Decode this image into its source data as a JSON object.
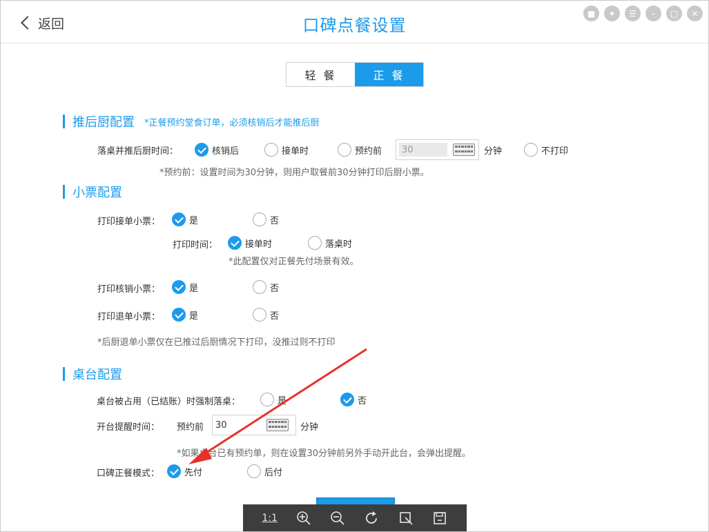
{
  "header": {
    "back_label": "返回",
    "title": "口碑点餐设置"
  },
  "tabs": [
    {
      "label": "轻 餐",
      "active": false
    },
    {
      "label": "正 餐",
      "active": true
    }
  ],
  "kitchen": {
    "heading": "推后厨配置",
    "note": "*正餐预约堂食订单，必须核销后才能推后厨",
    "row_label": "落桌并推后厨时间：",
    "options": [
      "核销后",
      "接单时",
      "预约前"
    ],
    "minutes_value": "30",
    "minutes_unit": "分钟",
    "no_print": "不打印",
    "hint": "*预约前：设置时间为30分钟，则用户取餐前30分钟打印后厨小票。"
  },
  "ticket": {
    "heading": "小票配置",
    "print_accept_label": "打印接单小票：",
    "yes": "是",
    "no": "否",
    "print_time_label": "打印时间：",
    "print_time_options": [
      "接单时",
      "落桌时"
    ],
    "print_time_hint": "*此配置仅对正餐先付场景有效。",
    "print_verify_label": "打印核销小票：",
    "print_refund_label": "打印退单小票：",
    "refund_hint": "*后厨退单小票仅在已推过后厨情况下打印，没推过则不打印"
  },
  "table": {
    "heading": "桌台配置",
    "force_label": "桌台被占用（已结账）时强制落桌：",
    "yes": "是",
    "no": "否",
    "remind_label": "开台提醒时间：",
    "remind_prefix": "预约前",
    "remind_value": "30",
    "remind_unit": "分钟",
    "remind_hint": "*如果桌台已有预约单，则在设置30分钟前另外手动开此台，会弹出提醒。",
    "mode_label": "口碑正餐模式：",
    "mode_options": [
      "先付",
      "后付"
    ]
  },
  "toolbar": {
    "ratio_label": "1:1"
  },
  "colors": {
    "accent": "#1c9bea",
    "arrow": "#e8302a",
    "toolbar": "#3d3d3d"
  }
}
